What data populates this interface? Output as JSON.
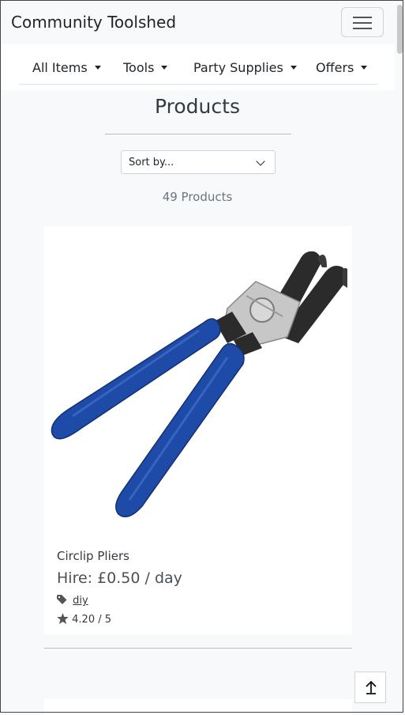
{
  "app": {
    "brand": "Community Toolshed"
  },
  "nav": {
    "items": [
      {
        "label": "All Items"
      },
      {
        "label": "Tools"
      },
      {
        "label": "Party Supplies"
      },
      {
        "label": "Offers"
      }
    ]
  },
  "page": {
    "title": "Products",
    "sort_value": "Sort by...",
    "count_text": "49 Products"
  },
  "product": {
    "name": "Circlip Pliers",
    "price": "Hire: £0.50 / day",
    "tag": "diy",
    "rating": "4.20 / 5",
    "handle_color": "#1e4aa8"
  },
  "icons": {
    "menu": "hamburger-icon",
    "sort": "chevron-down-icon",
    "tag": "tag-icon",
    "rating": "star-icon",
    "back_to_top": "arrow-up-icon"
  }
}
